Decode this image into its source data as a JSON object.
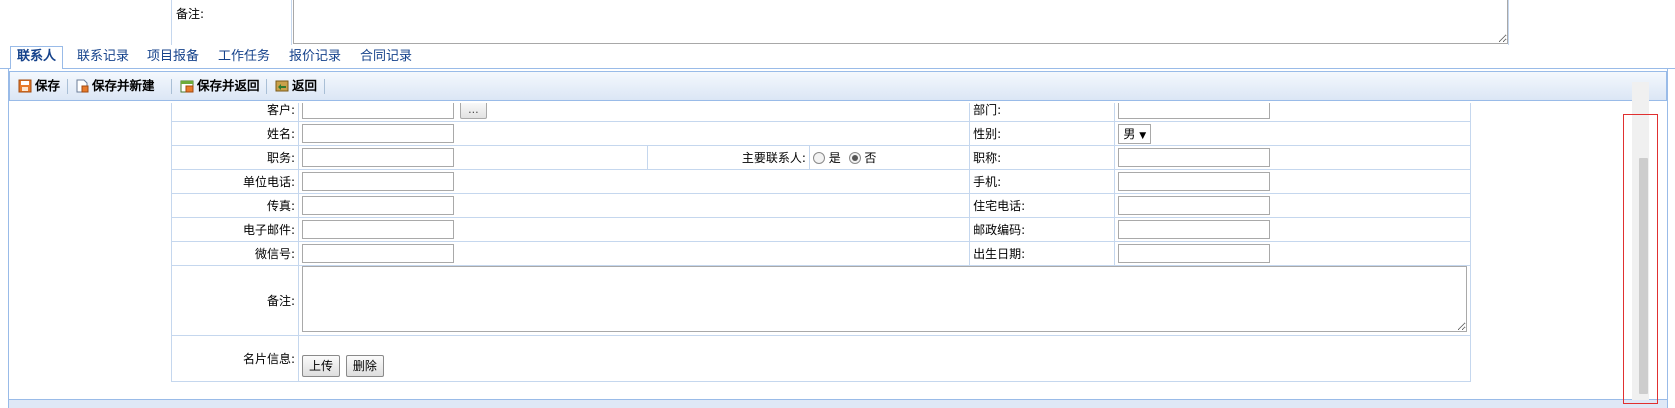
{
  "top_remark": {
    "label": "备注:"
  },
  "tabs": [
    {
      "label": "联系人",
      "active": true
    },
    {
      "label": "联系记录"
    },
    {
      "label": "项目报备"
    },
    {
      "label": "工作任务"
    },
    {
      "label": "报价记录"
    },
    {
      "label": "合同记录"
    }
  ],
  "toolbar": {
    "save": "保存",
    "save_new": "保存并新建",
    "save_return": "保存并返回",
    "return": "返回"
  },
  "form": {
    "customer_label": "客户:",
    "customer_btn": "...",
    "department_label": "部门:",
    "name_label": "姓名:",
    "gender_label": "性别:",
    "gender_value": "男",
    "position_label": "职务:",
    "primary_contact_label": "主要联系人:",
    "primary_yes": "是",
    "primary_no": "否",
    "title_label": "职称:",
    "office_phone_label": "单位电话:",
    "mobile_label": "手机:",
    "fax_label": "传真:",
    "home_phone_label": "住宅电话:",
    "email_label": "电子邮件:",
    "postcode_label": "邮政编码:",
    "wechat_label": "微信号:",
    "birthday_label": "出生日期:",
    "remark_label": "备注:",
    "card_label": "名片信息:",
    "upload_btn": "上传",
    "delete_btn": "删除"
  },
  "colors": {
    "tab_text": "#15428b",
    "border": "#99bbe8",
    "cell_border": "#c5d7ee",
    "highlight": "#e03030"
  }
}
